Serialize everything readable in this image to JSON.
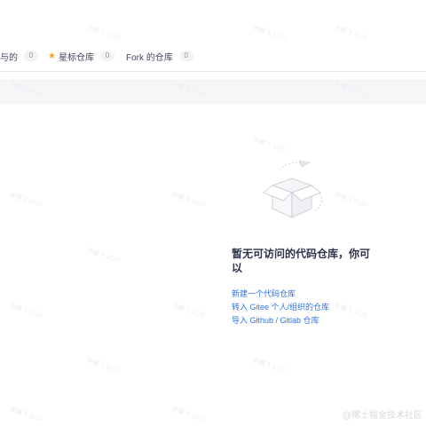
{
  "tabs": [
    {
      "label": "与的",
      "count": "0"
    },
    {
      "label": "星标仓库",
      "count": "0"
    },
    {
      "label": "Fork 的仓库",
      "count": "0"
    }
  ],
  "empty": {
    "title": "暂无可访问的代码仓库，你可以",
    "links": [
      "新建一个代码仓库",
      "转入 Gitee 个人/组织的仓库",
      "导入 Github / Gitlab 仓库"
    ]
  },
  "watermark": "禾曦飞 3120",
  "credit": "@稀土掘金技术社区",
  "colors": {
    "link": "#2f74e6",
    "star": "#f5a623",
    "border": "#e3e6ea"
  }
}
